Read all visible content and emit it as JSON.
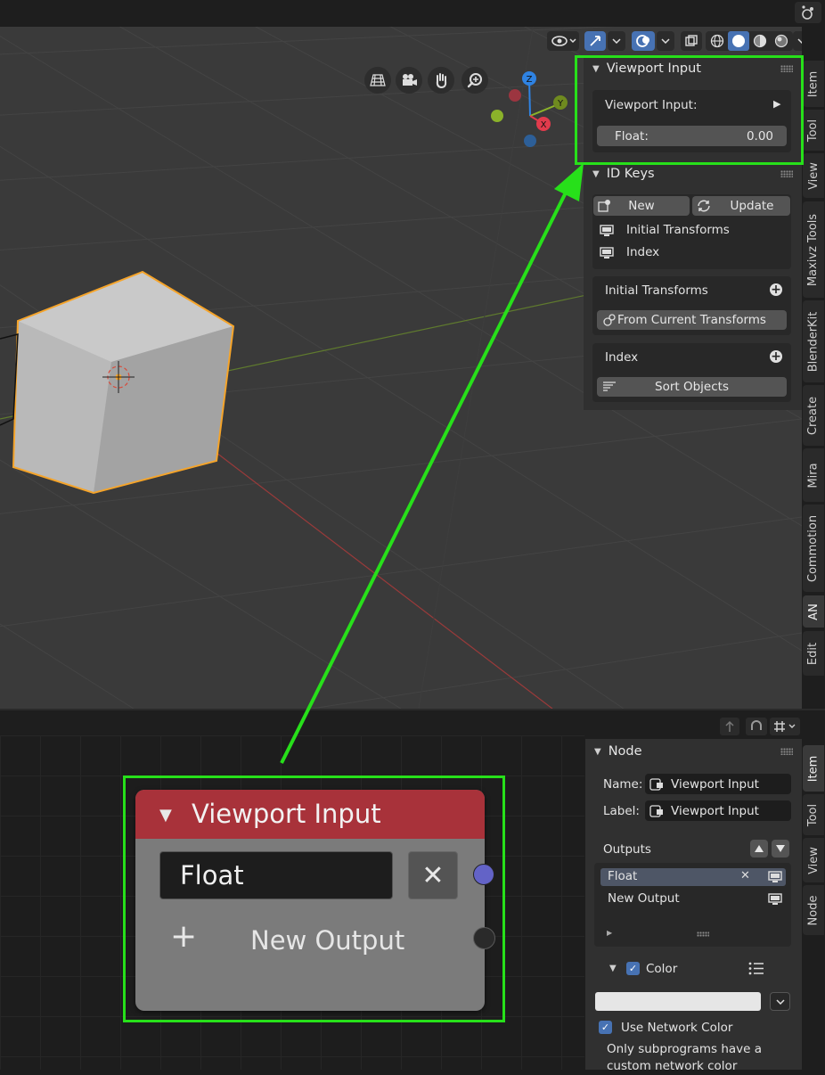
{
  "viewport": {
    "gizmo_axes": {
      "z": "Z",
      "y": "Y",
      "x": "X"
    }
  },
  "n_panel_top": {
    "viewport_input_panel": {
      "title": "Viewport Input",
      "subpanel_label": "Viewport Input:",
      "float_label": "Float:",
      "float_value": "0.00"
    },
    "id_keys_panel": {
      "title": "ID Keys",
      "new_label": "New",
      "update_label": "Update",
      "keys": [
        "Initial Transforms",
        "Index"
      ],
      "initial_transforms_section": "Initial Transforms",
      "from_current_transforms": "From Current Transforms",
      "index_section": "Index",
      "sort_objects": "Sort Objects"
    },
    "tabs": [
      "Item",
      "Tool",
      "View",
      "Maxivz Tools",
      "BlenderKit",
      "Create",
      "Mira",
      "Commotion",
      "AN",
      "Edit"
    ],
    "active_tab": "AN"
  },
  "node": {
    "title": "Viewport Input",
    "output_name": "Float",
    "new_output_label": "New Output",
    "plus_glyph": "+",
    "remove_glyph": "✕"
  },
  "n_panel_bottom": {
    "node_panel": {
      "title": "Node",
      "name_label": "Name:",
      "name_value": "Viewport Input",
      "label_label": "Label:",
      "label_value": "Viewport Input",
      "outputs_label": "Outputs",
      "outputs": [
        "Float",
        "New Output"
      ],
      "color_label": "Color",
      "color_checked": true,
      "swatch_color": "#e6e6e6",
      "use_network_color_label": "Use Network Color",
      "use_network_color_checked": true,
      "note": "Only subprograms have a custom network color"
    },
    "tabs": [
      "Item",
      "Tool",
      "View",
      "Node"
    ],
    "active_tab": "Item"
  },
  "colors": {
    "highlight": "#27e01a",
    "node_header": "#a8323a",
    "accent": "#4772b3",
    "socket": "#6363c7",
    "selection": "#f5a42a"
  }
}
